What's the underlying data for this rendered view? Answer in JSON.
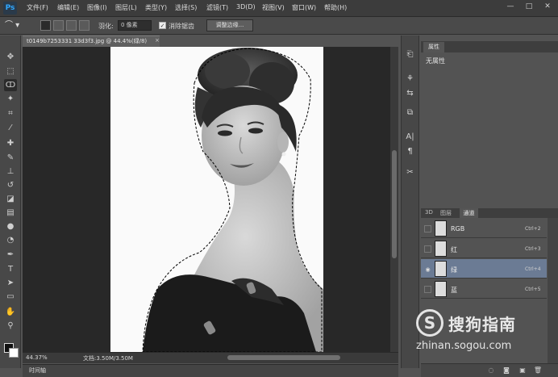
{
  "menu": {
    "logo": "Ps",
    "items": [
      "文件(F)",
      "编辑(E)",
      "图像(I)",
      "图层(L)",
      "类型(Y)",
      "选择(S)",
      "滤镜(T)",
      "3D(D)",
      "视图(V)",
      "窗口(W)",
      "帮助(H)"
    ]
  },
  "window_controls": [
    "—",
    "□",
    "✕"
  ],
  "options": {
    "feather_label": "羽化:",
    "feather_value": "0 像素",
    "antialias_label": "消除锯齿",
    "antialias_checked": true,
    "refine_edge_label": "调整边缘..."
  },
  "document": {
    "tab_title": "t0149b7253331 33d3f3.jpg @ 44.4%(绿/8)",
    "tab_close": "×",
    "zoom": "44.37%",
    "info": "文档:3.50M/3.50M"
  },
  "timeline_label": "时间轴",
  "properties": {
    "tab": "属性",
    "content": "无属性"
  },
  "channels": {
    "tabs": [
      "3D",
      "图层",
      "通道"
    ],
    "active_tab": "通道",
    "rows": [
      {
        "name": "RGB",
        "shortcut": "Ctrl+2",
        "visible": false,
        "selected": false
      },
      {
        "name": "红",
        "shortcut": "Ctrl+3",
        "visible": false,
        "selected": false
      },
      {
        "name": "绿",
        "shortcut": "Ctrl+4",
        "visible": true,
        "selected": true
      },
      {
        "name": "蓝",
        "shortcut": "Ctrl+5",
        "visible": false,
        "selected": false
      }
    ]
  },
  "watermark": {
    "logo_glyph": "S",
    "name": "搜狗指南",
    "url": "zhinan.sogou.com"
  },
  "colors": {
    "selected_channel": "#6b7b94",
    "ps_blue": "#31a8ff"
  }
}
